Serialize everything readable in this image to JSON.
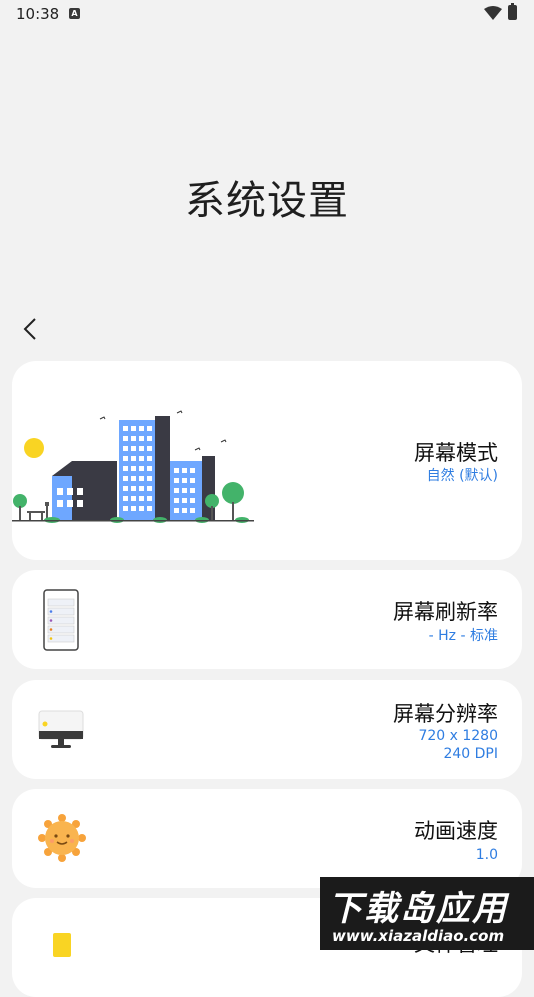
{
  "status": {
    "time": "10:38",
    "notification_glyph": "A"
  },
  "page": {
    "title": "系统设置"
  },
  "cards": [
    {
      "title": "屏幕模式",
      "sub1": "自然 (默认)"
    },
    {
      "title": "屏幕刷新率",
      "sub1": "- Hz - 标准"
    },
    {
      "title": "屏幕分辨率",
      "sub1": "720 x 1280",
      "sub2": "240 DPI"
    },
    {
      "title": "动画速度",
      "sub1": "1.0"
    },
    {
      "title": "文件管理"
    }
  ],
  "watermark": {
    "big": "下载岛应用",
    "small": "www.xiazaldiao.com"
  },
  "colors": {
    "accent": "#2f7de1",
    "building": "#6ea7ff",
    "building_dark": "#3a3a44",
    "tree": "#43b36a",
    "sun": "#f9d423"
  }
}
